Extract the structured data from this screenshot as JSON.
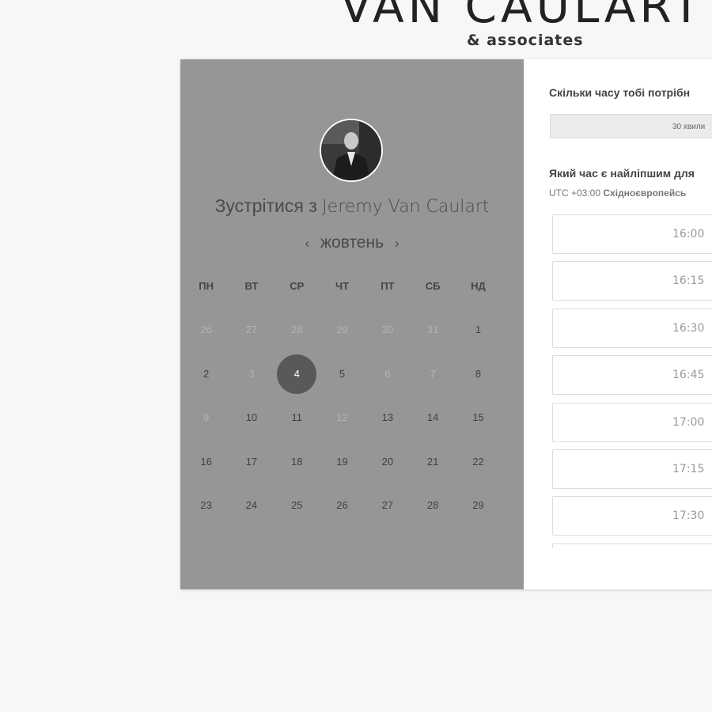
{
  "brand": {
    "title": "VAN CAULART",
    "subtitle": "& associates"
  },
  "calendar": {
    "meet_prefix": "Зустрітися з",
    "host_name": "Jeremy Van Caulart",
    "month_label": "жовтень",
    "prev_icon": "‹",
    "next_icon": "›",
    "weekdays": [
      "ПН",
      "ВТ",
      "СР",
      "ЧТ",
      "ПТ",
      "СБ",
      "НД"
    ],
    "weeks": [
      [
        "26",
        "27",
        "28",
        "29",
        "30",
        "31",
        "1"
      ],
      [
        "2",
        "3",
        "4",
        "5",
        "6",
        "7",
        "8"
      ],
      [
        "9",
        "10",
        "11",
        "12",
        "13",
        "14",
        "15"
      ],
      [
        "16",
        "17",
        "18",
        "19",
        "20",
        "21",
        "22"
      ],
      [
        "23",
        "24",
        "25",
        "26",
        "27",
        "28",
        "29"
      ]
    ],
    "selected_day": "4"
  },
  "booking": {
    "duration_question": "Скільки часу тобі потрібн",
    "duration_value": "30 хвили",
    "time_question": "Який час є найліпшим для",
    "timezone_offset": "UTC +03:00",
    "timezone_name": "Східноєвропейсь",
    "slots": [
      "16:00",
      "16:15",
      "16:30",
      "16:45",
      "17:00",
      "17:15",
      "17:30",
      ""
    ]
  },
  "colors": {
    "left_panel": "#969696",
    "selected_day_bg": "#595959",
    "page_bg": "#f7f7f7"
  }
}
